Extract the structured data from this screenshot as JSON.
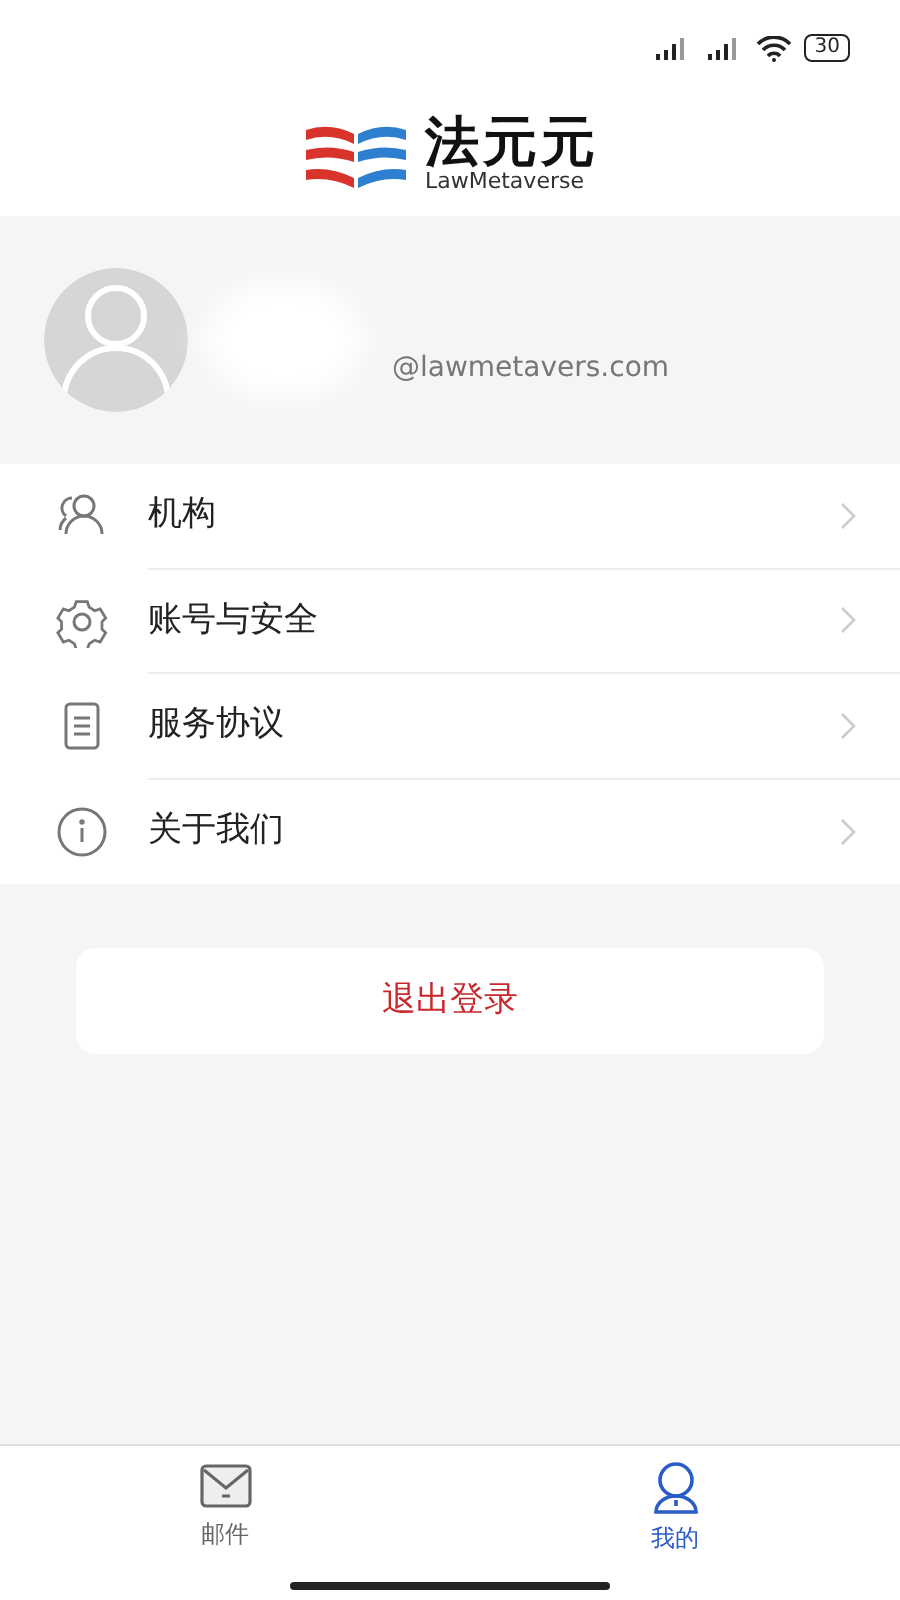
{
  "status_bar": {
    "battery": "30"
  },
  "logo": {
    "name": "法元元",
    "subtitle": "LawMetaverse"
  },
  "profile": {
    "email": "@lawmetavers.com"
  },
  "menu": [
    {
      "kind": "people",
      "label": "机构"
    },
    {
      "kind": "gear",
      "label": "账号与安全"
    },
    {
      "kind": "document",
      "label": "服务协议"
    },
    {
      "kind": "info",
      "label": "关于我们"
    }
  ],
  "logout_button": "退出登录",
  "tab_bar": [
    {
      "kind": "mail",
      "label": "邮件",
      "selected": false
    },
    {
      "kind": "person",
      "label": "我的",
      "selected": true
    }
  ]
}
